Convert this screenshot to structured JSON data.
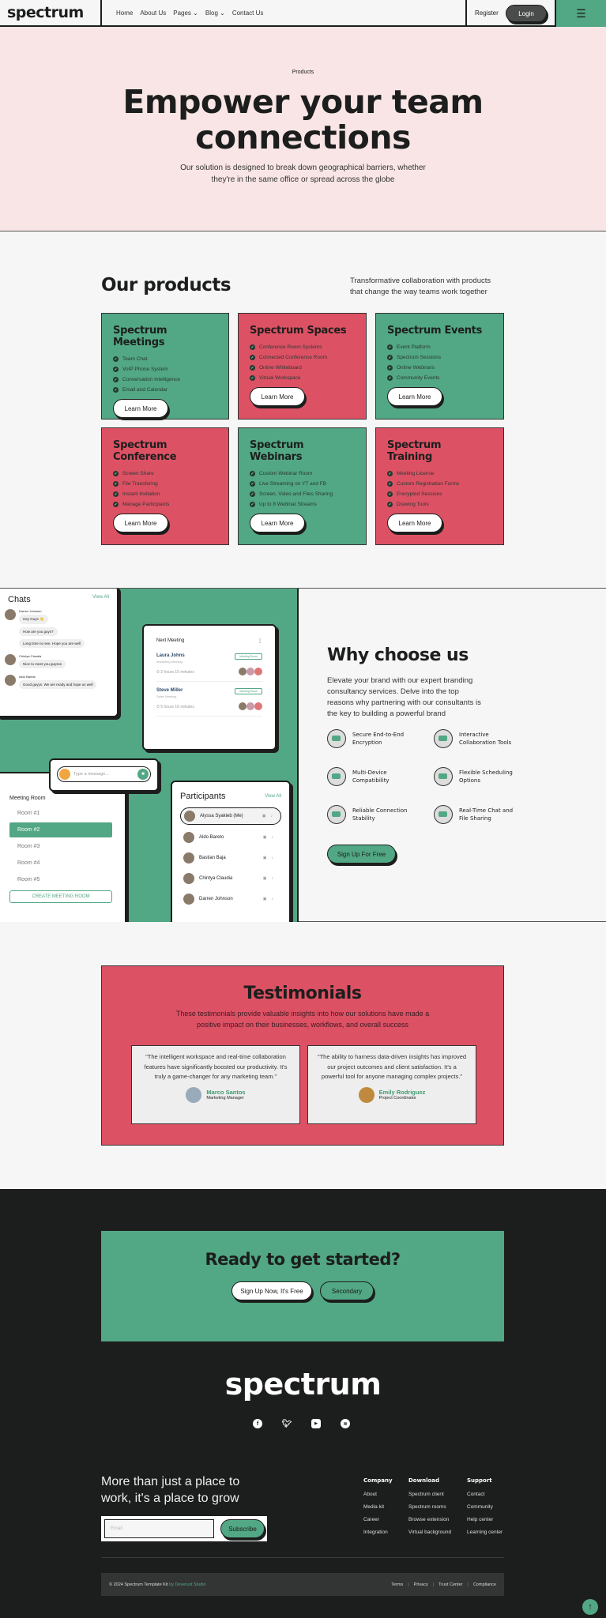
{
  "nav": {
    "logo": "spectrum",
    "links": [
      "Home",
      "About Us",
      "Pages",
      "Blog",
      "Contact Us"
    ],
    "register": "Register",
    "login": "Login"
  },
  "hero": {
    "eyebrow": "Products",
    "title_line1": "Empower your team",
    "title_line2": "connections",
    "subtitle_line1": "Our solution is designed to break down geographical barriers, whether",
    "subtitle_line2": "they're in the same office or spread across the globe"
  },
  "products": {
    "title": "Our products",
    "desc_line1": "Transformative collaboration with products",
    "desc_line2": "that change the way teams work together",
    "learn_more": "Learn More",
    "cards": [
      {
        "title": "Spectrum Meetings",
        "color": "green",
        "items": [
          "Team Chat",
          "VoIP Phone System",
          "Conversation Intelligence",
          "Email and Calendar"
        ]
      },
      {
        "title": "Spectrum Spaces",
        "color": "red",
        "items": [
          "Conference Room Systems",
          "Connected Conference Room",
          "Online Whiteboard",
          "Virtual Workspace"
        ]
      },
      {
        "title": "Spectrum Events",
        "color": "green",
        "items": [
          "Event Platform",
          "Spectrum Sessions",
          "Online Webinars",
          "Community Events"
        ]
      },
      {
        "title": "Spectrum Conference",
        "color": "red",
        "items": [
          "Screen Share",
          "File Transfering",
          "Instant Invitation",
          "Manage Participants"
        ]
      },
      {
        "title": "Spectrum Webinars",
        "color": "green",
        "items": [
          "Custom Webinar Room",
          "Live Streaming on YT and FB",
          "Screen, Video and Files Sharing",
          "Up to 8 Webinar Streams"
        ]
      },
      {
        "title": "Spectrum Training",
        "color": "red",
        "items": [
          "Meeting License",
          "Custom Registration Forms",
          "Encrypted Sessions",
          "Drawing Tools"
        ]
      }
    ]
  },
  "mockup": {
    "chats": {
      "title": "Chats",
      "view_all": "View All",
      "messages": [
        {
          "name": "Darren Johnson",
          "texts": [
            "Hey Guys 👋",
            "How are you guys?",
            "Long time no see. Hope you are well"
          ]
        },
        {
          "name": "Chintya Claudia",
          "texts": [
            "Nice to meet you guysss"
          ]
        },
        {
          "name": "Aldo Bareto",
          "texts": [
            "Good guyys. We are ready and hope us well"
          ]
        }
      ]
    },
    "next_meeting": {
      "title": "Next Meeting",
      "meetings": [
        {
          "name": "Laura Johns",
          "type": "Marketing Meeting",
          "time": "2 hours 15 minutes",
          "badge": "Meeting Room"
        },
        {
          "name": "Steve Miller",
          "type": "Sales Meeting",
          "time": "5 hours 10 minutes",
          "badge": "Meeting Room"
        }
      ]
    },
    "message_placeholder": "Type a message...",
    "meeting_room": {
      "title": "Meeting Room",
      "rooms": [
        "Room #1",
        "Room #2",
        "Room #3",
        "Room #4",
        "Room #5"
      ],
      "create": "CREATE MEETING ROOM"
    },
    "participants": {
      "title": "Participants",
      "view_all": "View All",
      "people": [
        "Alyssa Syakieb (Me)",
        "Aldo Bareto",
        "Bastian Baja",
        "Chintya Claudia",
        "Darren Johnson"
      ]
    }
  },
  "why": {
    "title": "Why choose us",
    "desc_line1": "Elevate your brand with our expert branding",
    "desc_line2": "consultancy services. Delve into the top",
    "desc_line3": "reasons why partnering with our consultants is",
    "desc_line4": "the key to building a powerful brand",
    "features": [
      [
        "Secure End-to-End",
        "Encryption"
      ],
      [
        "Interactive",
        "Collaboration Tools"
      ],
      [
        "Multi-Device",
        "Compatibility"
      ],
      [
        "Flexible Scheduling",
        "Options"
      ],
      [
        "Reliable Connection",
        "Stability"
      ],
      [
        "Real-Time Chat and",
        "File Sharing"
      ]
    ],
    "cta": "Sign Up For Free"
  },
  "testimonials": {
    "title": "Testimonials",
    "desc_line1": "These testimonials provide valuable insights into how our solutions have made a",
    "desc_line2": "positive impact on their businesses, workflows, and overall success",
    "items": [
      {
        "quote": "\"The intelligent workspace and real-time collaboration features have significantly boosted our productivity. It's truly a game-changer for any marketing team.\"",
        "name": "Marco Santos",
        "role": "Marketing Manager"
      },
      {
        "quote": "\"The ability to harness data-driven insights has improved our project outcomes and client satisfaction. It's a powerful tool for anyone managing complex projects.\"",
        "name": "Emily Rodriguez",
        "role": "Project Coordinator"
      }
    ]
  },
  "cta": {
    "title": "Ready to get started?",
    "primary": "Sign Up Now, It's Free",
    "secondary": "Secondary"
  },
  "footer": {
    "logo": "spectrum",
    "social": [
      "facebook-icon",
      "twitter-icon",
      "youtube-icon",
      "spotify-icon"
    ],
    "tagline_line1": "More than just a place to",
    "tagline_line2": "work, it's a place to grow",
    "email_placeholder": "Email",
    "subscribe": "Subscribe",
    "columns": [
      {
        "title": "Company",
        "links": [
          "About",
          "Media kit",
          "Career",
          "Integration"
        ]
      },
      {
        "title": "Download",
        "links": [
          "Spectrum client",
          "Spectrum rooms",
          "Browse extension",
          "Virtual background"
        ]
      },
      {
        "title": "Support",
        "links": [
          "Contact",
          "Community",
          "Help center",
          "Learning center"
        ]
      }
    ],
    "copyright": "© 2024 Spectrum Template Kit",
    "credit": "by Deverust Studio",
    "legal": [
      "Terms",
      "Privacy",
      "Trust Center",
      "Compliance"
    ]
  },
  "colors": {
    "green": "#52a784",
    "red": "#dd5164",
    "dark": "#1c1e1d",
    "pink": "#f9e5e5"
  }
}
